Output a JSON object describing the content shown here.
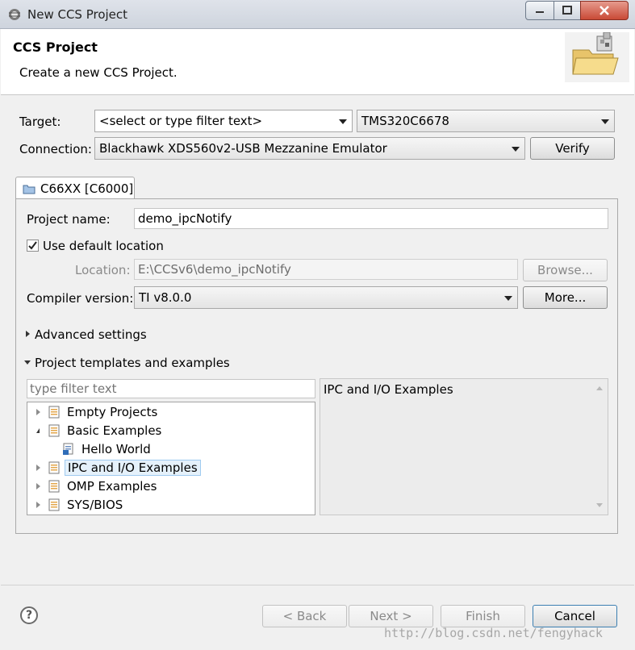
{
  "window": {
    "title": "New CCS Project"
  },
  "banner": {
    "title": "CCS Project",
    "description": "Create a new CCS Project."
  },
  "target": {
    "label": "Target:",
    "filter_value": "<select or type filter text>",
    "device_value": "TMS320C6678"
  },
  "connection": {
    "label": "Connection:",
    "value": "Blackhawk XDS560v2-USB Mezzanine Emulator",
    "verify_label": "Verify"
  },
  "tab": {
    "label": "C66XX [C6000]"
  },
  "project": {
    "name_label": "Project name:",
    "name_value": "demo_ipcNotify",
    "default_location_label": "Use default location",
    "default_location_checked": true,
    "location_label": "Location:",
    "location_value": "E:\\CCSv6\\demo_ipcNotify",
    "browse_label": "Browse...",
    "compiler_label": "Compiler version:",
    "compiler_value": "TI v8.0.0",
    "more_label": "More..."
  },
  "sections": {
    "advanced": "Advanced settings",
    "templates": "Project templates and examples"
  },
  "templates": {
    "filter_placeholder": "type filter text",
    "items": [
      {
        "label": "Empty Projects",
        "expanded": false
      },
      {
        "label": "Basic Examples",
        "expanded": true
      },
      {
        "label": "Hello World",
        "child": true
      },
      {
        "label": "IPC and I/O Examples",
        "expanded": false,
        "selected": true
      },
      {
        "label": "OMP Examples",
        "expanded": false
      },
      {
        "label": "SYS/BIOS",
        "expanded": false
      }
    ],
    "description": "IPC and I/O Examples"
  },
  "footer": {
    "back_label": "< Back",
    "next_label": "Next >",
    "finish_label": "Finish",
    "cancel_label": "Cancel",
    "watermark": "http://blog.csdn.net/fengyhack"
  }
}
